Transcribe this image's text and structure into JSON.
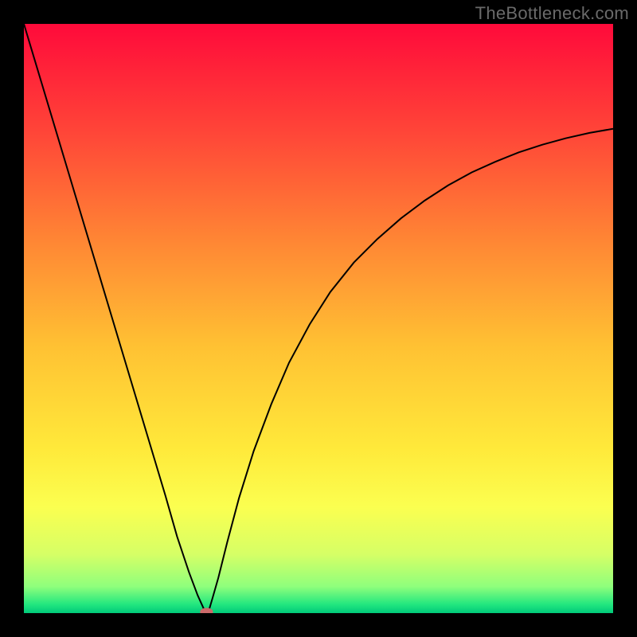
{
  "watermark": "TheBottleneck.com",
  "chart_data": {
    "type": "line",
    "title": "",
    "xlabel": "",
    "ylabel": "",
    "xlim": [
      0,
      100
    ],
    "ylim": [
      0,
      100
    ],
    "background": {
      "type": "vertical-gradient",
      "stops": [
        {
          "pos": 0.0,
          "color": "#ff0a3a"
        },
        {
          "pos": 0.18,
          "color": "#ff4438"
        },
        {
          "pos": 0.38,
          "color": "#ff8a34"
        },
        {
          "pos": 0.55,
          "color": "#ffc233"
        },
        {
          "pos": 0.72,
          "color": "#ffe93a"
        },
        {
          "pos": 0.82,
          "color": "#fbff50"
        },
        {
          "pos": 0.9,
          "color": "#d6ff66"
        },
        {
          "pos": 0.955,
          "color": "#8fff7c"
        },
        {
          "pos": 0.985,
          "color": "#23e77f"
        },
        {
          "pos": 1.0,
          "color": "#00c97a"
        }
      ]
    },
    "series": [
      {
        "name": "curve",
        "color": "#000000",
        "width": 2,
        "x": [
          0.0,
          3.0,
          6.0,
          9.0,
          12.0,
          15.0,
          18.0,
          21.0,
          24.0,
          26.0,
          28.0,
          29.5,
          30.5,
          31.0,
          31.5,
          32.0,
          33.0,
          34.5,
          36.5,
          39.0,
          42.0,
          45.0,
          48.5,
          52.0,
          56.0,
          60.0,
          64.0,
          68.0,
          72.0,
          76.0,
          80.0,
          84.0,
          88.0,
          92.0,
          96.0,
          100.0
        ],
        "y": [
          100.0,
          90.0,
          80.0,
          70.0,
          60.0,
          50.0,
          40.0,
          30.0,
          20.0,
          13.0,
          7.0,
          3.0,
          0.8,
          0.2,
          0.8,
          2.5,
          6.0,
          12.0,
          19.5,
          27.5,
          35.5,
          42.5,
          49.0,
          54.5,
          59.5,
          63.5,
          67.0,
          70.0,
          72.6,
          74.8,
          76.6,
          78.2,
          79.5,
          80.6,
          81.5,
          82.2
        ]
      }
    ],
    "marker": {
      "name": "min-point",
      "x": 31.0,
      "y": 0.2,
      "rx": 1.1,
      "ry": 0.7,
      "color": "#cc6a6a"
    }
  }
}
